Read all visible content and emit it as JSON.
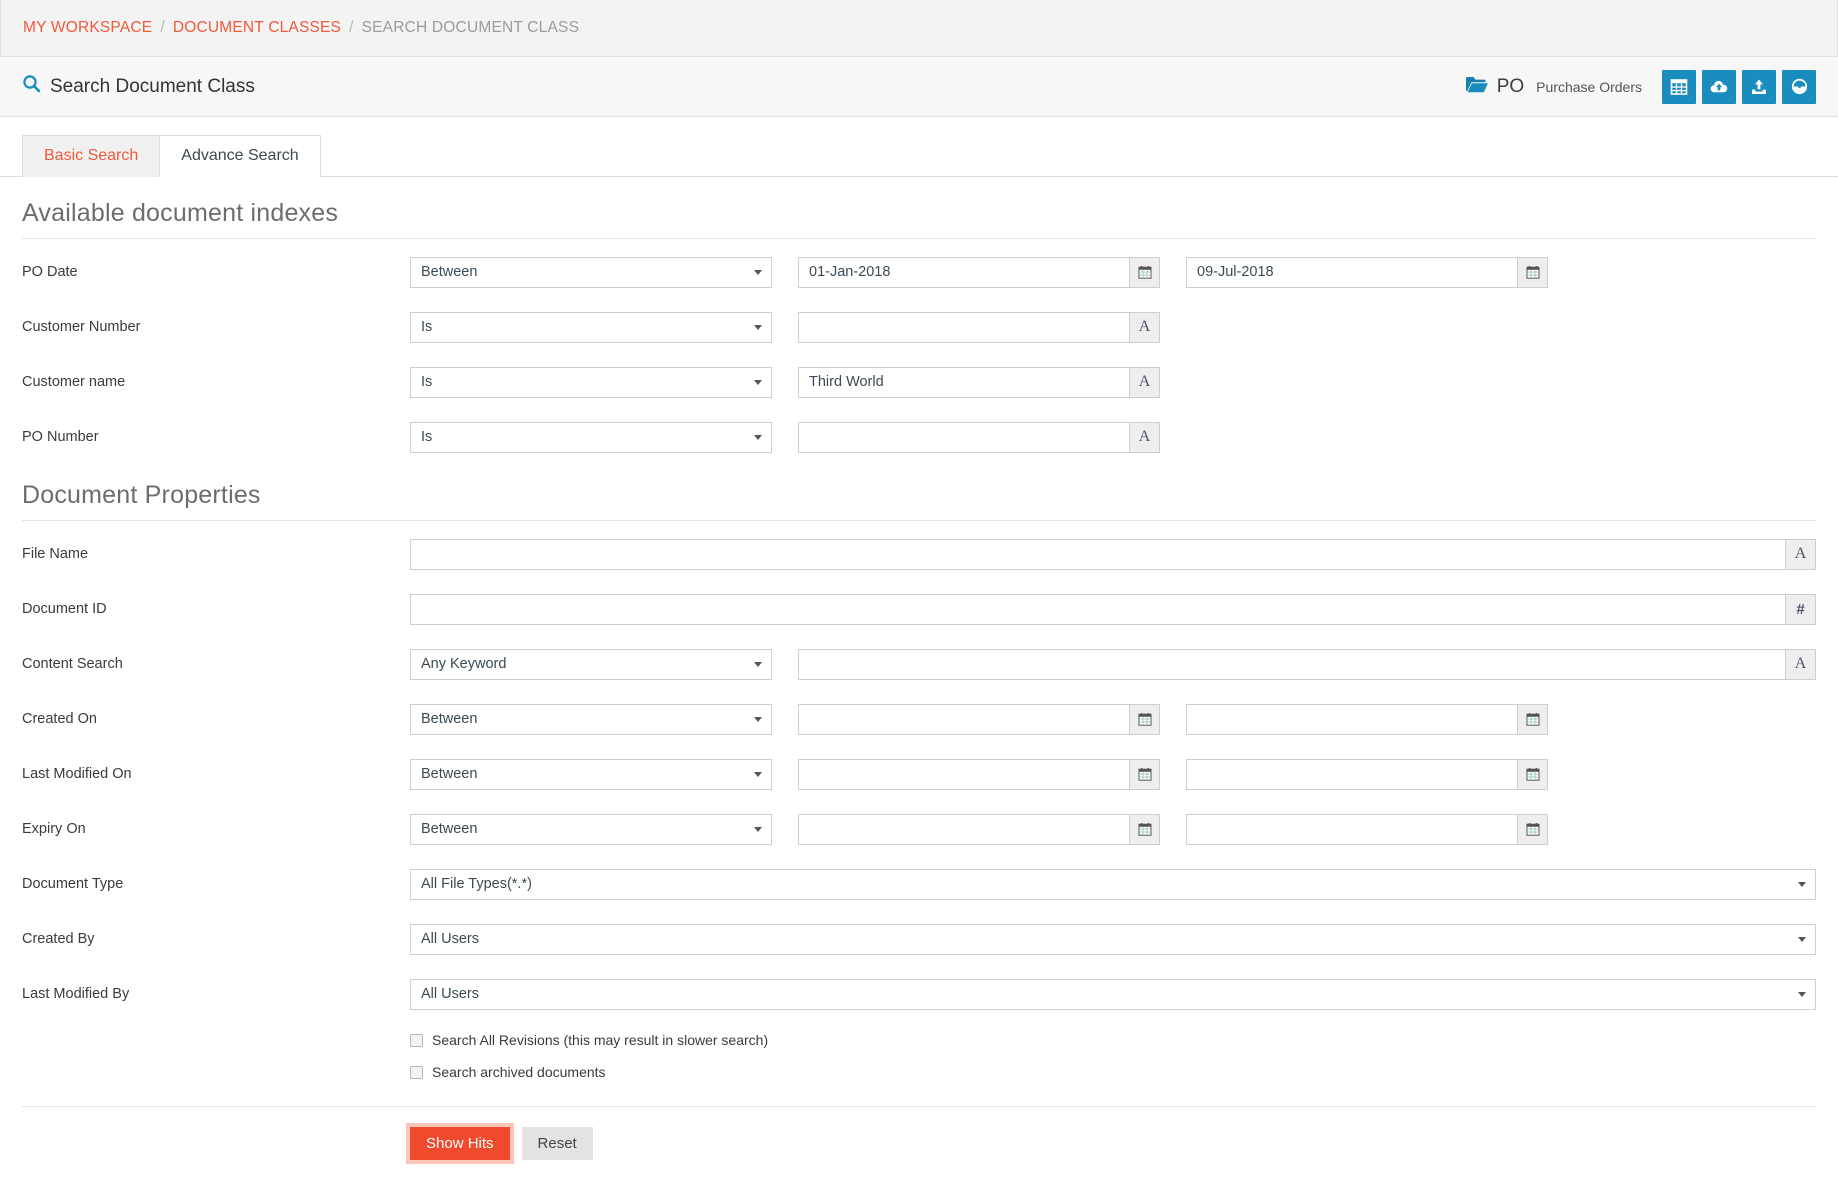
{
  "breadcrumb": {
    "items": [
      {
        "label": "MY WORKSPACE",
        "type": "link"
      },
      {
        "label": "DOCUMENT CLASSES",
        "type": "link"
      },
      {
        "label": "SEARCH DOCUMENT CLASS",
        "type": "current"
      }
    ],
    "separator": "/"
  },
  "header": {
    "title": "Search Document Class",
    "search_icon": "search-icon",
    "folder": {
      "icon": "folder-icon",
      "code": "PO",
      "name": "Purchase Orders"
    },
    "buttons": [
      {
        "icon": "grid-table-icon",
        "name": "grid-view-button"
      },
      {
        "icon": "cloud-upload-icon",
        "name": "cloud-upload-button"
      },
      {
        "icon": "upload-icon",
        "name": "upload-button"
      },
      {
        "icon": "dashboard-gauge-icon",
        "name": "dashboard-button"
      }
    ]
  },
  "tabs": [
    {
      "label": "Basic Search",
      "active": true
    },
    {
      "label": "Advance Search",
      "active": false
    }
  ],
  "sections": {
    "indexes": {
      "title": "Available document indexes",
      "rows": [
        {
          "label": "PO Date",
          "operator": "Between",
          "value_from": "01-Jan-2018",
          "value_to": "09-Jul-2018",
          "addon": "calendar-icon"
        },
        {
          "label": "Customer Number",
          "operator": "Is",
          "value": "",
          "addon": "A"
        },
        {
          "label": "Customer name",
          "operator": "Is",
          "value": "Third World",
          "addon": "A"
        },
        {
          "label": "PO Number",
          "operator": "Is",
          "value": "",
          "addon": "A"
        }
      ]
    },
    "properties": {
      "title": "Document Properties",
      "file_name": {
        "label": "File Name",
        "value": "",
        "addon": "A"
      },
      "document_id": {
        "label": "Document ID",
        "value": "",
        "addon": "#"
      },
      "content_search": {
        "label": "Content Search",
        "operator": "Any Keyword",
        "value": "",
        "addon": "A"
      },
      "created_on": {
        "label": "Created On",
        "operator": "Between",
        "value_from": "",
        "value_to": ""
      },
      "last_modified_on": {
        "label": "Last Modified On",
        "operator": "Between",
        "value_from": "",
        "value_to": ""
      },
      "expiry_on": {
        "label": "Expiry On",
        "operator": "Between",
        "value_from": "",
        "value_to": ""
      },
      "document_type": {
        "label": "Document Type",
        "value": "All File Types(*.*)"
      },
      "created_by": {
        "label": "Created By",
        "value": "All Users"
      },
      "last_modified_by": {
        "label": "Last Modified By",
        "value": "All Users"
      },
      "checkboxes": [
        {
          "label": "Search All Revisions (this may result in slower search)",
          "checked": false
        },
        {
          "label": "Search archived documents",
          "checked": false
        }
      ]
    }
  },
  "footer": {
    "show_hits_label": "Show Hits",
    "reset_label": "Reset"
  },
  "colors": {
    "accent_orange": "#ef4a2d",
    "accent_blue": "#1b8cbe",
    "crumb_link": "#ef5a3d"
  }
}
